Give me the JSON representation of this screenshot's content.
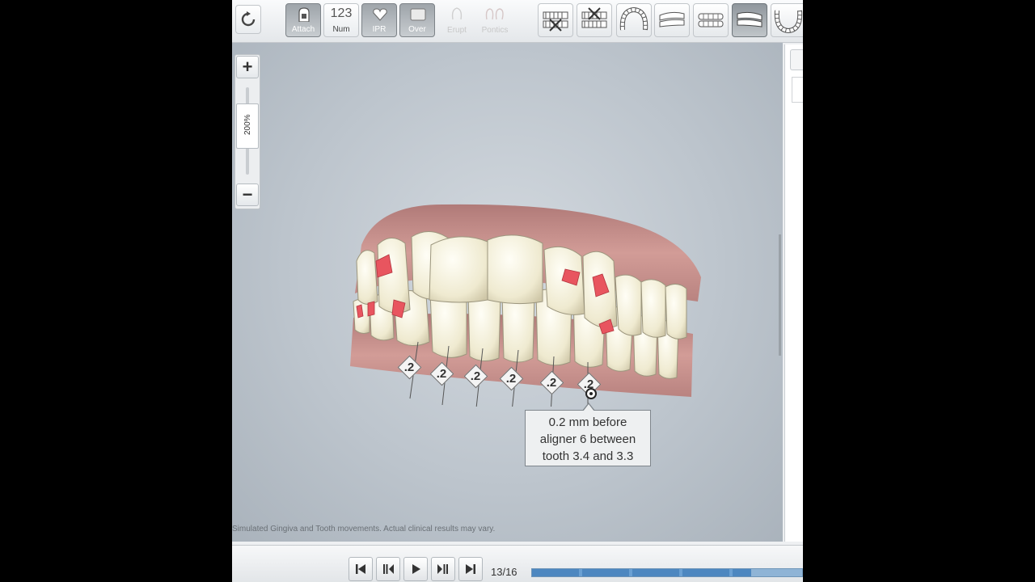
{
  "toolbar": {
    "refresh_icon": "refresh-icon",
    "buttons": [
      {
        "id": "attach",
        "label": "Attach",
        "icon": "attachment-icon",
        "state": "active"
      },
      {
        "id": "num",
        "label": "Num",
        "glyph": "123",
        "state": "plain"
      },
      {
        "id": "ipr",
        "label": "IPR",
        "icon": "heart-icon",
        "state": "active"
      },
      {
        "id": "over",
        "label": "Over",
        "icon": "overlay-icon",
        "state": "active"
      },
      {
        "id": "erupt",
        "label": "Erupt",
        "icon": "erupt-icon",
        "state": "disabled"
      },
      {
        "id": "pontics",
        "label": "Pontics",
        "icon": "pontics-icon",
        "state": "disabled"
      }
    ],
    "view_buttons": [
      {
        "id": "view-maxillary-hidden",
        "icon": "upper-arch-hidden-icon"
      },
      {
        "id": "view-mandibular-hidden",
        "icon": "lower-arch-hidden-icon"
      },
      {
        "id": "view-occlusal-upper",
        "icon": "upper-occlusal-icon"
      },
      {
        "id": "view-left",
        "icon": "left-buccal-icon"
      },
      {
        "id": "view-front",
        "icon": "frontal-icon"
      },
      {
        "id": "view-right",
        "icon": "right-buccal-icon",
        "active": true
      },
      {
        "id": "view-occlusal-lower",
        "icon": "lower-occlusal-icon"
      }
    ]
  },
  "zoom": {
    "plus": "+",
    "minus": "−",
    "level": "200%"
  },
  "ipr_labels": [
    ".2",
    ".2",
    ".2",
    ".2",
    ".2",
    ".2"
  ],
  "tooltip": {
    "line1": "0.2 mm before",
    "line2": "aligner 6 between",
    "line3": "tooth 3.4 and 3.3"
  },
  "disclaimer": "Simulated Gingiva and Tooth movements.  Actual clinical results may vary.",
  "playback": {
    "counter": "13/16",
    "progress": 0.8125
  },
  "colors": {
    "attachment": "#e8555f",
    "gingiva": "#c98b86",
    "tooth": "#f3efdc",
    "background": "#bcc4cc",
    "timeline": "#4d87c0"
  }
}
